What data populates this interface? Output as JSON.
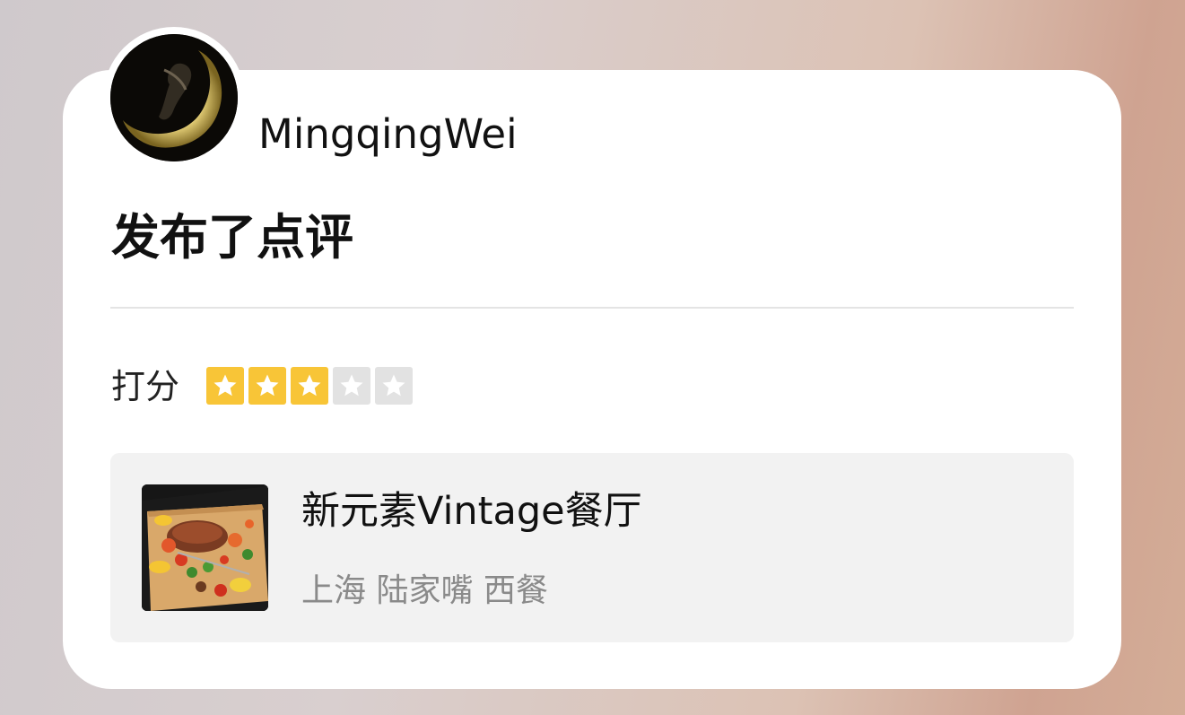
{
  "user": {
    "name": "MingqingWei",
    "avatar_icon": "avatar-moon-image"
  },
  "post": {
    "action_text": "发布了点评"
  },
  "rating": {
    "label": "打分",
    "stars_filled": 3,
    "stars_total": 5,
    "filled_color": "#f8c537",
    "empty_color": "#e2e2e2"
  },
  "place": {
    "name": "新元素Vintage餐厅",
    "meta": "上海 陆家嘴 西餐",
    "thumbnail_icon": "food-platter-image"
  }
}
